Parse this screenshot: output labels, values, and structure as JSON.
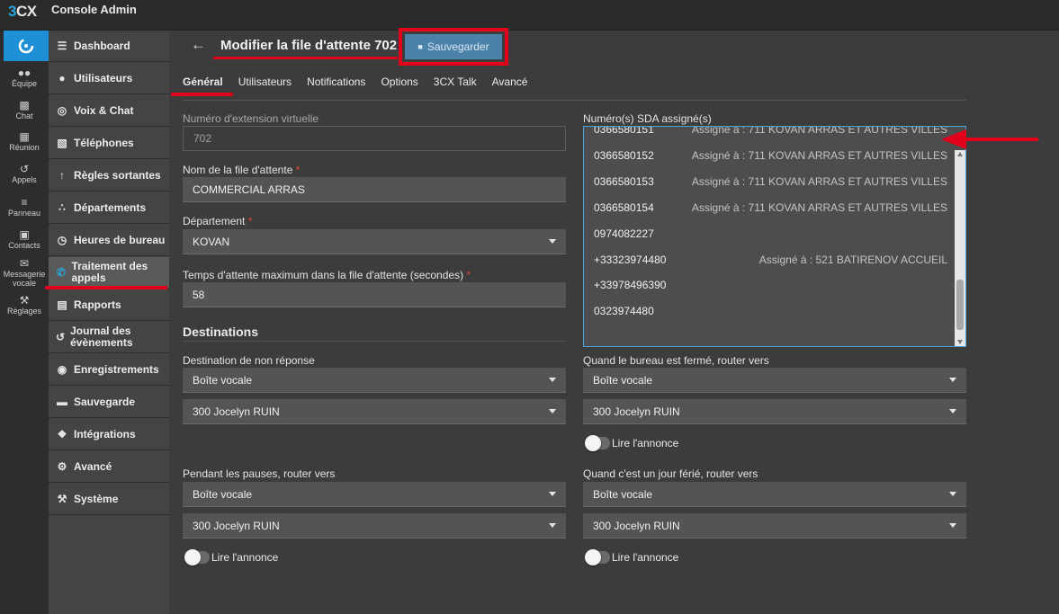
{
  "app": {
    "logo_three": "3",
    "logo_cx": "CX",
    "title": "Console Admin"
  },
  "rail": [
    {
      "label": "Équipe",
      "icon": "team-icon"
    },
    {
      "label": "Chat",
      "icon": "chat-icon"
    },
    {
      "label": "Réunion",
      "icon": "meeting-icon"
    },
    {
      "label": "Appels",
      "icon": "history-icon"
    },
    {
      "label": "Panneau",
      "icon": "panel-icon"
    },
    {
      "label": "Contacts",
      "icon": "contacts-icon"
    },
    {
      "label": "Messagerie vocale",
      "icon": "voicemail-icon"
    },
    {
      "label": "Réglages",
      "icon": "wrench-icon"
    }
  ],
  "nav": [
    {
      "label": "Dashboard",
      "icon": "dashboard-icon"
    },
    {
      "label": "Utilisateurs",
      "icon": "user-icon"
    },
    {
      "label": "Voix & Chat",
      "icon": "globe-icon"
    },
    {
      "label": "Téléphones",
      "icon": "phones-icon"
    },
    {
      "label": "Règles sortantes",
      "icon": "arrow-up-icon"
    },
    {
      "label": "Départements",
      "icon": "departments-icon"
    },
    {
      "label": "Heures de bureau",
      "icon": "clock-icon"
    },
    {
      "label": "Traitement des appels",
      "icon": "phone-icon"
    },
    {
      "label": "Rapports",
      "icon": "reports-icon"
    },
    {
      "label": "Journal des évènements",
      "icon": "history-icon"
    },
    {
      "label": "Enregistrements",
      "icon": "record-icon"
    },
    {
      "label": "Sauvegarde",
      "icon": "archive-icon"
    },
    {
      "label": "Intégrations",
      "icon": "puzzle-icon"
    },
    {
      "label": "Avancé",
      "icon": "gear-icon"
    },
    {
      "label": "Système",
      "icon": "wrench-icon"
    }
  ],
  "header": {
    "title": "Modifier la file d'attente 702",
    "save_label": "Sauvegarder"
  },
  "tabs": [
    "Général",
    "Utilisateurs",
    "Notifications",
    "Options",
    "3CX Talk",
    "Avancé"
  ],
  "form": {
    "virtual_ext_label": "Numéro d'extension virtuelle",
    "virtual_ext_value": "702",
    "queue_name_label": "Nom de la file d'attente",
    "queue_name_value": "COMMERCIAL ARRAS",
    "department_label": "Département",
    "department_value": "KOVAN",
    "max_wait_label": "Temps d'attente maximum dans la file d'attente (secondes)",
    "max_wait_value": "58",
    "required_mark": "*",
    "sda_label": "Numéro(s) SDA assigné(s)"
  },
  "sda": [
    {
      "number": "0366580151",
      "assigned": "Assigné à : 711 KOVAN ARRAS ET AUTRES VILLES"
    },
    {
      "number": "0366580152",
      "assigned": "Assigné à : 711 KOVAN ARRAS ET AUTRES VILLES"
    },
    {
      "number": "0366580153",
      "assigned": "Assigné à : 711 KOVAN ARRAS ET AUTRES VILLES"
    },
    {
      "number": "0366580154",
      "assigned": "Assigné à : 711 KOVAN ARRAS ET AUTRES VILLES"
    },
    {
      "number": "0974082227",
      "assigned": ""
    },
    {
      "number": "+33323974480",
      "assigned": "Assigné à : 521 BATIRENOV ACCUEIL"
    },
    {
      "number": "+33978496390",
      "assigned": ""
    },
    {
      "number": "0323974480",
      "assigned": ""
    }
  ],
  "destinations": {
    "section_title": "Destinations",
    "no_answer_label": "Destination de non réponse",
    "no_answer_type": "Boîte vocale",
    "no_answer_target": "300 Jocelyn RUIN",
    "closed_label": "Quand le bureau est fermé, router vers",
    "closed_type": "Boîte vocale",
    "closed_target": "300 Jocelyn RUIN",
    "closed_announce": "Lire l'annonce",
    "breaks_label": "Pendant les pauses, router vers",
    "breaks_type": "Boîte vocale",
    "breaks_target": "300 Jocelyn RUIN",
    "breaks_announce": "Lire l'annonce",
    "holiday_label": "Quand c'est un jour férié, router vers",
    "holiday_type": "Boîte vocale",
    "holiday_target": "300 Jocelyn RUIN",
    "holiday_announce": "Lire l'annonce"
  },
  "colors": {
    "accent": "#1f8fd6",
    "annotation": "#e0001b",
    "save_button": "#4a82aa"
  }
}
